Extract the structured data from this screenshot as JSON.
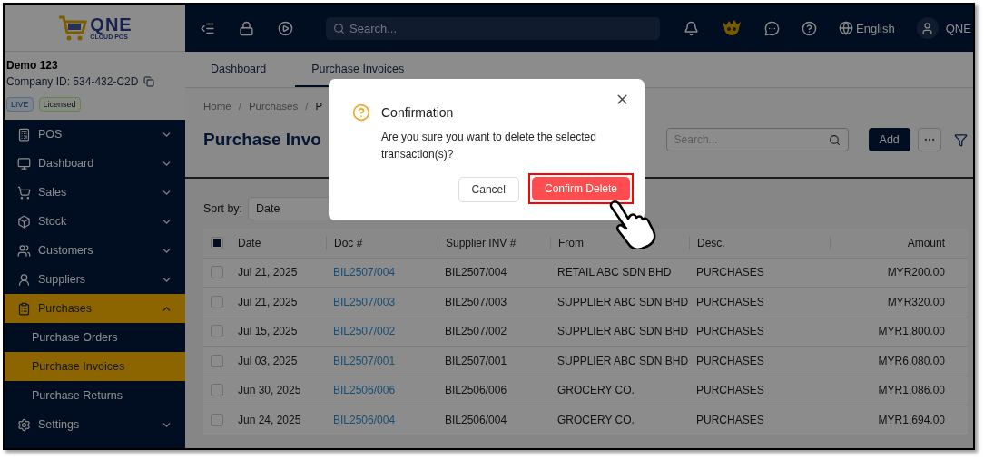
{
  "logo": {
    "name": "QNE",
    "tagline": "CLOUD POS"
  },
  "topbar": {
    "search": {
      "placeholder": "Search..."
    },
    "language": "English",
    "user": "QNE"
  },
  "company": {
    "name": "Demo 123",
    "id": "Company ID: 534-432-C2D",
    "badges": [
      {
        "label": "LIVE",
        "kind": "live"
      },
      {
        "label": "Licensed",
        "kind": "licensed"
      }
    ]
  },
  "sidebar": {
    "items": [
      {
        "label": "POS",
        "expanded": false,
        "selected": false
      },
      {
        "label": "Dashboard",
        "expanded": false,
        "selected": false
      },
      {
        "label": "Sales",
        "expanded": false,
        "selected": false
      },
      {
        "label": "Stock",
        "expanded": false,
        "selected": false
      },
      {
        "label": "Customers",
        "expanded": false,
        "selected": false
      },
      {
        "label": "Suppliers",
        "expanded": false,
        "selected": false
      },
      {
        "label": "Purchases",
        "expanded": true,
        "selected": true,
        "children": [
          {
            "label": "Purchase Orders",
            "selected": false
          },
          {
            "label": "Purchase Invoices",
            "selected": true
          },
          {
            "label": "Purchase Returns",
            "selected": false
          }
        ]
      },
      {
        "label": "Settings",
        "expanded": false,
        "selected": false
      }
    ]
  },
  "tabs": [
    {
      "label": "Dashboard",
      "selected": false
    },
    {
      "label": "Purchase Invoices",
      "selected": true
    }
  ],
  "breadcrumb": {
    "separator": "/",
    "items": [
      "Home",
      "Purchases",
      "P"
    ]
  },
  "page_title": "Purchase Invo",
  "toolbar": {
    "search": {
      "placeholder": "Search..."
    },
    "add_button": "Add"
  },
  "sort": {
    "label": "Sort by:",
    "value": "Date"
  },
  "table": {
    "select_all": {
      "indeterminate": true
    },
    "columns": [
      "Date",
      "Doc #",
      "Supplier INV #",
      "From",
      "Desc.",
      "Amount"
    ],
    "rows": [
      {
        "checked": false,
        "cells": [
          "Jul 21, 2025",
          "BIL2507/004",
          "BIL2507/004",
          "RETAIL ABC SDN BHD",
          "PURCHASES",
          "MYR200.00"
        ]
      },
      {
        "checked": false,
        "cells": [
          "Jul 21, 2025",
          "BIL2507/003",
          "BIL2507/003",
          "SUPPLIER ABC SDN BHD",
          "PURCHASES",
          "MYR320.00"
        ]
      },
      {
        "checked": false,
        "cells": [
          "Jul 15, 2025",
          "BIL2507/002",
          "BIL2507/002",
          "SUPPLIER ABC SDN BHD",
          "PURCHASES",
          "MYR1,800.00"
        ]
      },
      {
        "checked": false,
        "cells": [
          "Jul 03, 2025",
          "BIL2507/001",
          "BIL2507/001",
          "SUPPLIER ABC SDN BHD",
          "PURCHASES",
          "MYR6,080.00"
        ]
      },
      {
        "checked": false,
        "cells": [
          "Jun 30, 2025",
          "BIL2506/006",
          "BIL2506/006",
          "GROCERY CO.",
          "PURCHASES",
          "MYR1,086.00"
        ]
      },
      {
        "checked": false,
        "cells": [
          "Jun 24, 2025",
          "BIL2506/004",
          "BIL2506/004",
          "GROCERY CO.",
          "PURCHASES",
          "MYR1,694.00"
        ]
      }
    ]
  },
  "dialog": {
    "title": "Confirmation",
    "message": "Are you sure you want to delete the selected transaction(s)?",
    "cancel": "Cancel",
    "confirm": "Confirm Delete",
    "confirm_highlighted": true
  }
}
